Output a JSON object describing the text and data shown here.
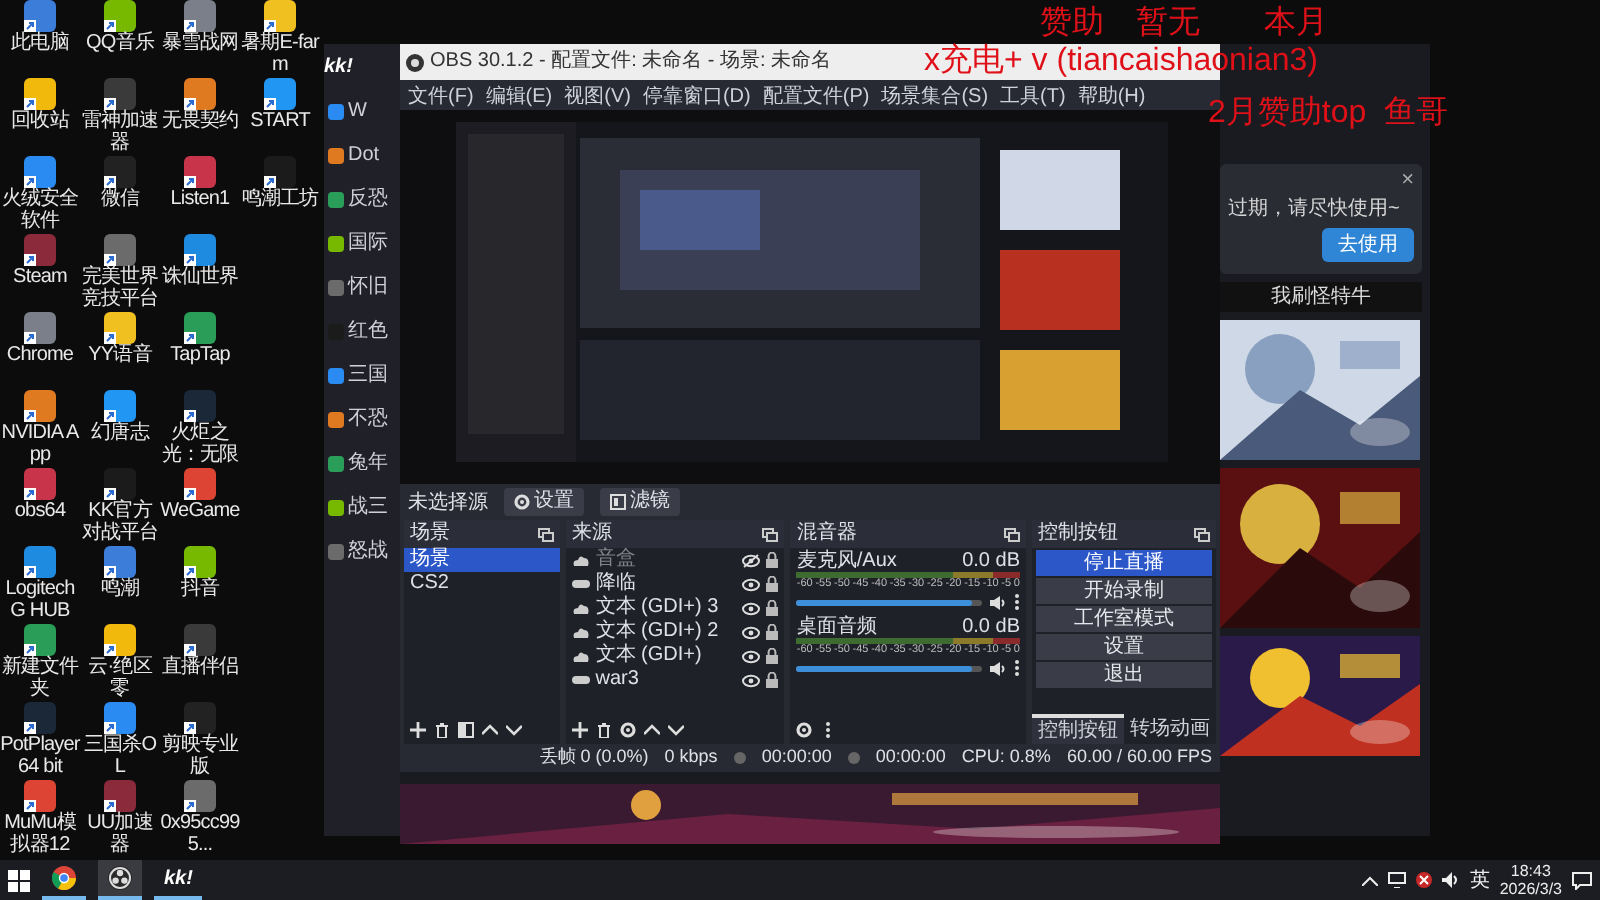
{
  "desktop_icons": [
    {
      "label": "此电脑"
    },
    {
      "label": "回收站"
    },
    {
      "label": "火绒安全软件"
    },
    {
      "label": "Steam"
    },
    {
      "label": "Chrome"
    },
    {
      "label": "NVIDIA App"
    },
    {
      "label": "obs64"
    },
    {
      "label": "Logitech G HUB"
    },
    {
      "label": "新建文件夹"
    },
    {
      "label": "PotPlayer 64 bit"
    },
    {
      "label": "MuMu模拟器12"
    },
    {
      "label": "QQ音乐"
    },
    {
      "label": "雷神加速器"
    },
    {
      "label": "微信"
    },
    {
      "label": "完美世界竞技平台"
    },
    {
      "label": "YY语音"
    },
    {
      "label": "幻唐志"
    },
    {
      "label": "KK官方对战平台"
    },
    {
      "label": "鸣潮"
    },
    {
      "label": "云·绝区零"
    },
    {
      "label": "三国杀OL"
    },
    {
      "label": "UU加速器"
    },
    {
      "label": "暴雪战网"
    },
    {
      "label": "无畏契约"
    },
    {
      "label": "Listen1"
    },
    {
      "label": "诛仙世界"
    },
    {
      "label": "TapTap"
    },
    {
      "label": "火炬之光：无限"
    },
    {
      "label": "WeGame"
    },
    {
      "label": "抖音"
    },
    {
      "label": "直播伴侣"
    },
    {
      "label": "剪映专业版"
    },
    {
      "label": "0x95cc995..."
    },
    {
      "label": "暑期E-farm"
    },
    {
      "label": "START"
    },
    {
      "label": "鸣潮工坊"
    }
  ],
  "background_app": {
    "logo": "kk!",
    "sidebar_items": [
      {
        "label": "W"
      },
      {
        "label": "Dot"
      },
      {
        "label": "反恐"
      },
      {
        "label": "国际"
      },
      {
        "label": "怀旧"
      },
      {
        "label": "红色"
      },
      {
        "label": "三国"
      },
      {
        "label": "不恐"
      },
      {
        "label": "兔年"
      },
      {
        "label": "战三"
      },
      {
        "label": "怒战"
      }
    ],
    "dialog": {
      "close": "×",
      "message": "过期，请尽快使用~",
      "button": "去使用"
    },
    "caption": "我刷怪特牛"
  },
  "obs": {
    "title": "OBS 30.1.2 - 配置文件: 未命名 - 场景: 未命名",
    "menu": [
      "文件(F)",
      "编辑(E)",
      "视图(V)",
      "停靠窗口(D)",
      "配置文件(P)",
      "场景集合(S)",
      "工具(T)",
      "帮助(H)"
    ],
    "source_toolbar": {
      "label": "未选择源",
      "buttons": [
        "设置",
        "滤镜"
      ]
    },
    "scenes": {
      "title": "场景",
      "items": [
        {
          "label": "场景",
          "selected": true
        },
        {
          "label": "CS2",
          "selected": false
        }
      ]
    },
    "sources": {
      "title": "来源",
      "items": [
        {
          "label": "音盒",
          "kind": "text",
          "visible": false
        },
        {
          "label": "降临",
          "kind": "game",
          "visible": true
        },
        {
          "label": "文本 (GDI+) 3",
          "kind": "text",
          "visible": true
        },
        {
          "label": "文本 (GDI+) 2",
          "kind": "text",
          "visible": true
        },
        {
          "label": "文本 (GDI+)",
          "kind": "text",
          "visible": true
        },
        {
          "label": "war3",
          "kind": "game",
          "visible": true
        }
      ]
    },
    "mixer": {
      "title": "混音器",
      "channels": [
        {
          "name": "麦克风/Aux",
          "reading": "0.0 dB",
          "level": 0.95,
          "ticks": [
            "-60",
            "-55",
            "-50",
            "-45",
            "-40",
            "-35",
            "-30",
            "-25",
            "-20",
            "-15",
            "-10",
            "-5",
            "0"
          ]
        },
        {
          "name": "桌面音频",
          "reading": "0.0 dB",
          "level": 0.95,
          "ticks": [
            "-60",
            "-55",
            "-50",
            "-45",
            "-40",
            "-35",
            "-30",
            "-25",
            "-20",
            "-15",
            "-10",
            "-5",
            "0"
          ]
        }
      ]
    },
    "controls": {
      "title": "控制按钮",
      "buttons": [
        {
          "label": "停止直播",
          "active": true
        },
        {
          "label": "开始录制",
          "active": false
        },
        {
          "label": "工作室模式",
          "active": false
        },
        {
          "label": "设置",
          "active": false
        },
        {
          "label": "退出",
          "active": false
        }
      ]
    },
    "dock_tabs": [
      {
        "label": "控制按钮",
        "selected": true
      },
      {
        "label": "转场动画",
        "selected": false
      }
    ],
    "status_bar": {
      "dropped": "丢帧 0 (0.0%)",
      "bitrate": "0 kbps",
      "stream_time": "00:00:00",
      "record_time": "00:00:00",
      "cpu": "CPU: 0.8%",
      "fps": "60.00 / 60.00 FPS"
    }
  },
  "overlay_texts": [
    "赞助　暂无　　本月",
    "x充电+ v (tiancaishaonian3)",
    "2月赞助top  鱼哥"
  ],
  "taskbar": {
    "apps": [
      {
        "kind": "browser",
        "selected": false
      },
      {
        "kind": "obs",
        "selected": true
      },
      {
        "label": "kk!",
        "kind": "kk",
        "selected": false
      }
    ],
    "language": "英",
    "time": "18:43",
    "date": "2026/3/3"
  }
}
